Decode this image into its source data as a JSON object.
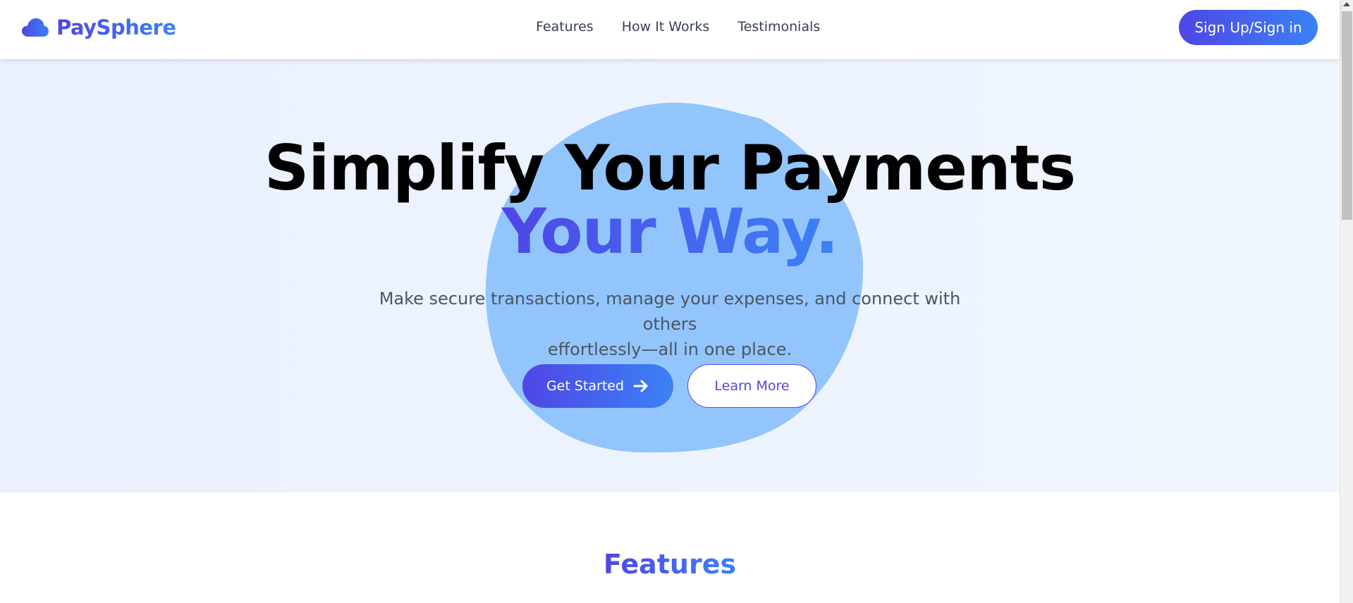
{
  "header": {
    "brand_name": "PaySphere",
    "brand_icon": "cloud-icon",
    "nav": [
      {
        "label": "Features"
      },
      {
        "label": "How It Works"
      },
      {
        "label": "Testimonials"
      }
    ],
    "signup_label": "Sign Up/Sign in"
  },
  "hero": {
    "title": "Simplify Your Payments",
    "title_accent": "Your Way.",
    "subtitle_line1": "Make secure transactions, manage your expenses, and connect with others",
    "subtitle_line2": "effortlessly—all in one place.",
    "primary_button": "Get Started",
    "primary_button_icon": "arrow-right-icon",
    "secondary_button": "Learn More"
  },
  "features": {
    "title": "Features"
  },
  "colors": {
    "accent_start": "#4f46e5",
    "accent_end": "#3b82f6",
    "blob": "#93c5fd",
    "hero_bg": "#eef4fe"
  }
}
